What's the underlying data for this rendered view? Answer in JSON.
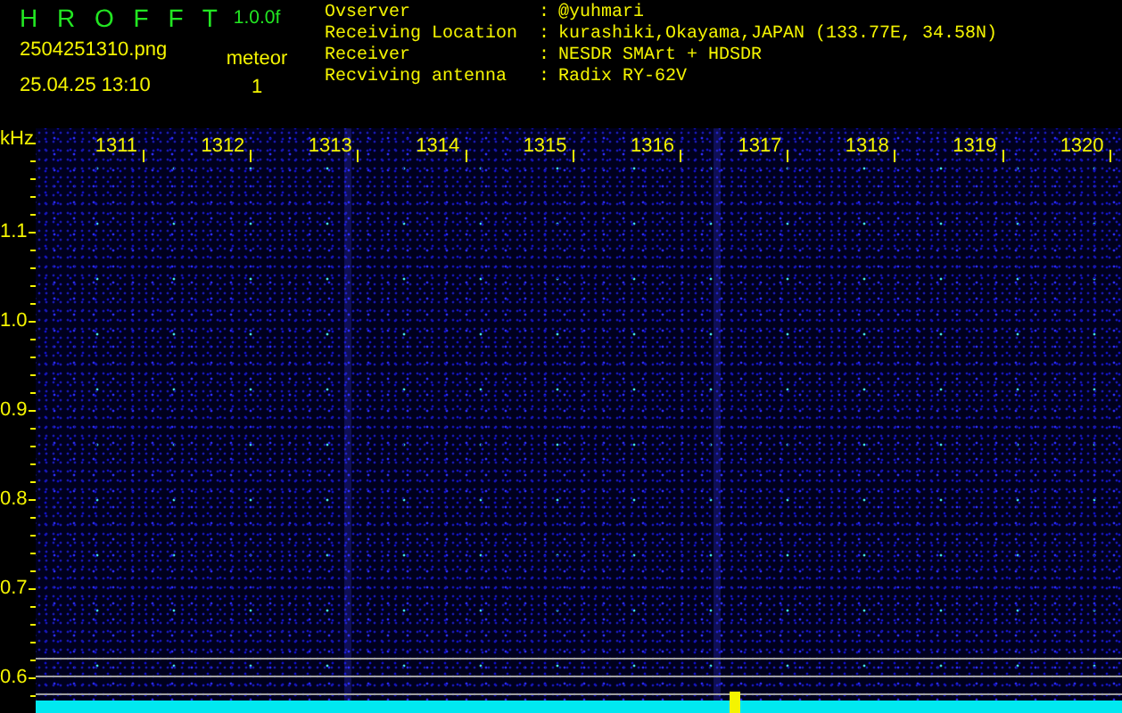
{
  "app": {
    "title": "H R O F F T",
    "version": "1.0.0f"
  },
  "file": {
    "name": "2504251310.png",
    "datetime": "25.04.25 13:10"
  },
  "meteor": {
    "label": "meteor",
    "count": "1"
  },
  "station": [
    {
      "label": "Ovserver",
      "separator": ":",
      "value": "@yuhmari"
    },
    {
      "label": "Receiving Location",
      "separator": ":",
      "value": "kurashiki,Okayama,JAPAN (133.77E, 34.58N)"
    },
    {
      "label": "Receiver",
      "separator": ":",
      "value": "NESDR SMArt + HDSDR"
    },
    {
      "label": "Recviving antenna",
      "separator": ":",
      "value": "Radix RY-62V"
    }
  ],
  "spectrogram": {
    "y_unit": "kHz",
    "y_labels": [
      "1.1",
      "1.0",
      "0.9",
      "0.8",
      "0.7",
      "0.6"
    ],
    "time_labels": [
      "1311",
      "1312",
      "1313",
      "1314",
      "1315",
      "1316",
      "1317",
      "1318",
      "1319",
      "1320"
    ]
  }
}
